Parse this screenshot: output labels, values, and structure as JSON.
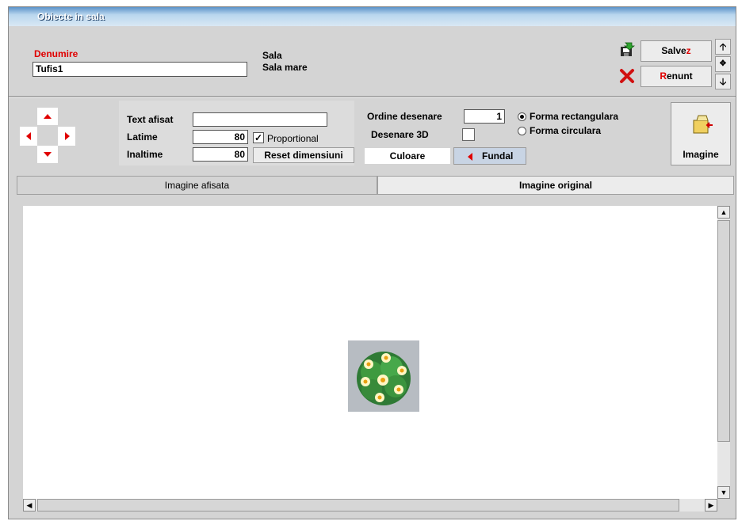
{
  "window": {
    "title": "Obiecte in sala"
  },
  "form": {
    "denumire_label": "Denumire",
    "denumire_value": "Tufis1",
    "sala_label": "Sala",
    "sala_value": "Sala mare"
  },
  "actions": {
    "save_label": "Salvez",
    "cancel_label": "Renunt"
  },
  "props": {
    "text_label": "Text afisat",
    "text_value": "",
    "width_label": "Latime",
    "width_value": "80",
    "height_label": "Inaltime",
    "height_value": "80",
    "proportional_label": "Proportional",
    "proportional_checked": true,
    "reset_label": "Reset dimensiuni",
    "order_label": "Ordine desenare",
    "order_value": "1",
    "draw3d_label": "Desenare 3D",
    "color_label": "Culoare",
    "background_label": "Fundal",
    "shape_options": [
      "Forma rectangulara",
      "Forma circulara"
    ],
    "shape_selected": "Forma rectangulara",
    "image_label": "Imagine"
  },
  "tabs": [
    {
      "label": "Imagine afisata",
      "active": false
    },
    {
      "label": "Imagine original",
      "active": true
    }
  ],
  "colors": {
    "accent_red": "#e00000",
    "title_blue": "#5b93c9",
    "fundal_tab": "#c8d4e4"
  },
  "image": {
    "icon": "flower-bush-icon"
  }
}
